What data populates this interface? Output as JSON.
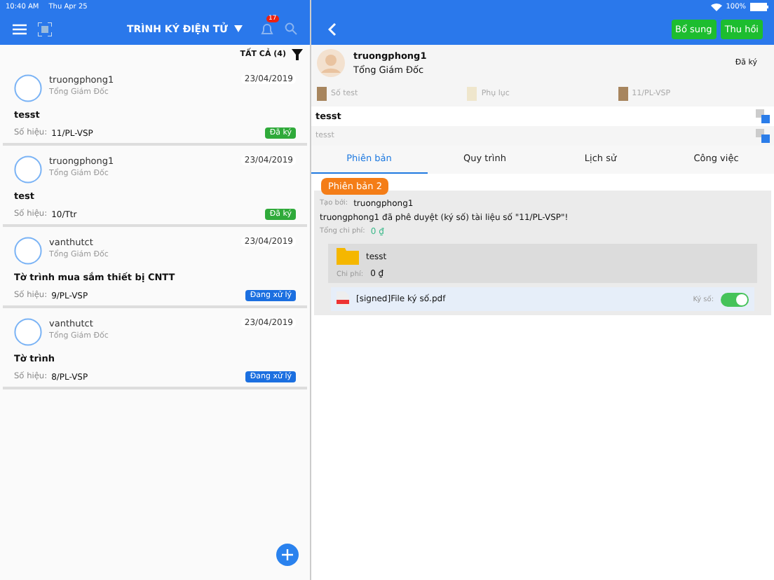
{
  "status_bar": {
    "time": "10:40 AM",
    "date": "Thu Apr 25",
    "battery": "100%"
  },
  "left_header": {
    "title": "TRÌNH KÝ ĐIỆN TỬ",
    "notification_count": "17"
  },
  "filter": {
    "label": "TẤT CẢ (4)"
  },
  "documents": [
    {
      "user": "truongphong1",
      "role": "Tổng Giám Đốc",
      "date": "23/04/2019",
      "title": "tesst",
      "number_label": "Số hiệu:",
      "number": "11/PL-VSP",
      "status": "Đã ký",
      "kind": "signed"
    },
    {
      "user": "truongphong1",
      "role": "Tổng Giám Đốc",
      "date": "23/04/2019",
      "title": "test",
      "number_label": "Số hiệu:",
      "number": "10/Ttr",
      "status": "Đã ký",
      "kind": "signed"
    },
    {
      "user": "vanthutct",
      "role": "Tổng Giám Đốc",
      "date": "23/04/2019",
      "title": "Tờ trình mua sắm thiết bị CNTT",
      "number_label": "Số hiệu:",
      "number": "9/PL-VSP",
      "status": "Đang xử lý",
      "kind": "processing"
    },
    {
      "user": "vanthutct",
      "role": "Tổng Giám Đốc",
      "date": "23/04/2019",
      "title": "Tờ trình",
      "number_label": "Số hiệu:",
      "number": "8/PL-VSP",
      "status": "Đang xử lý",
      "kind": "processing"
    }
  ],
  "right_header": {
    "buttons": [
      "Bổ sung",
      "Thu hồi"
    ]
  },
  "detail": {
    "user": "truongphong1",
    "role": "Tổng Giám Đốc",
    "status": "Đã ký",
    "attachments": [
      "Số test",
      "Phụ lục",
      "11/PL-VSP"
    ],
    "title": "tesst",
    "subtitle": "tesst"
  },
  "tabs": [
    {
      "label": "Phiên bản",
      "selected": true
    },
    {
      "label": "Quy trình",
      "selected": false
    },
    {
      "label": "Lịch sử",
      "selected": false
    },
    {
      "label": "Công việc",
      "selected": false
    }
  ],
  "version": {
    "badge": "Phiên bản 2",
    "created_by_label": "Tạo bởi:",
    "created_by": "truongphong1",
    "message": "truongphong1 đã phê duyệt (ký số) tài liệu số \"11/PL-VSP\"!",
    "total_cost_label": "Tổng chi phí:",
    "total_cost": "0 ₫",
    "folder": {
      "name": "tesst",
      "cost_label": "Chi phí:",
      "cost": "0 ₫"
    },
    "file": {
      "name": "[signed]File ký số.pdf",
      "sign_label": "Ký số:",
      "signed": true
    }
  }
}
